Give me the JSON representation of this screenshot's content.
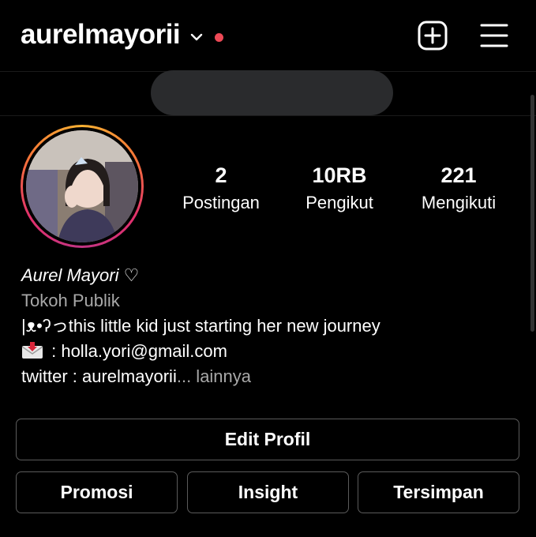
{
  "header": {
    "username": "aurelmayorii",
    "dropdown_icon": "chevron-down-icon",
    "notification_dot_color": "#ed4956",
    "new_post_icon": "plus-square-icon",
    "menu_icon": "hamburger-menu-icon"
  },
  "profile": {
    "avatar_icon": "profile-photo",
    "stats": [
      {
        "count": "2",
        "label": "Postingan"
      },
      {
        "count": "10RB",
        "label": "Pengikut"
      },
      {
        "count": "221",
        "label": "Mengikuti"
      }
    ],
    "name": "Aurel Mayori ♡",
    "category": "Tokoh Publik",
    "bio_line1": "|ᴥ•ʔっthis little kid just starting her new journey",
    "bio_email_icon": "envelope-arrow-icon",
    "bio_email": " : holla.yori@gmail.com",
    "bio_twitter": "twitter : aurelmayorii",
    "bio_ellipsis": "...",
    "bio_more": " lainnya"
  },
  "buttons": {
    "edit_profile": "Edit Profil",
    "promote": "Promosi",
    "insight": "Insight",
    "saved": "Tersimpan"
  },
  "colors": {
    "background": "#000000",
    "secondary_text": "#a8a8a8",
    "button_border": "#5b5b5b",
    "redaction": "#2a2b2d"
  }
}
